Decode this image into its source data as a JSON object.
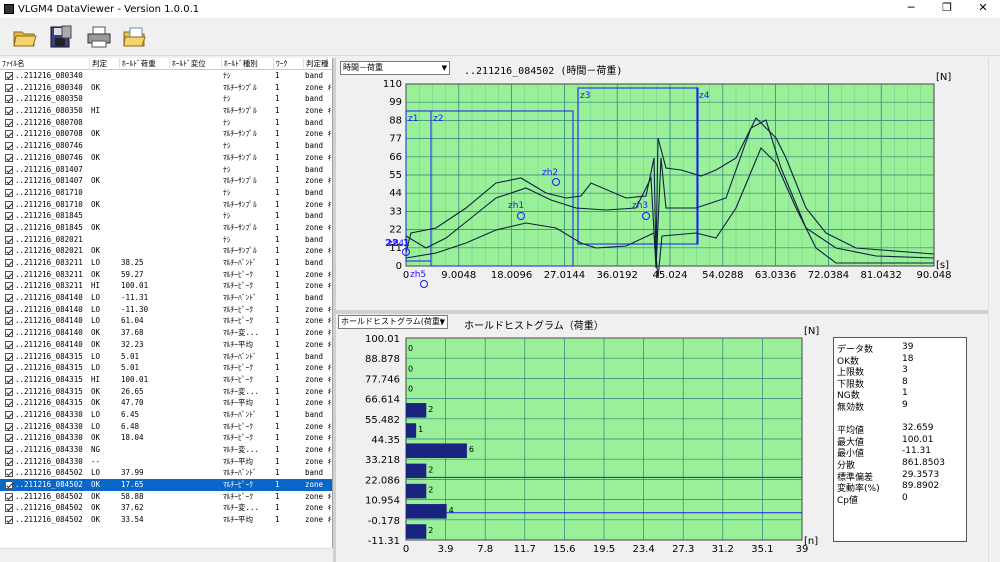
{
  "window": {
    "title": "VLGM4 DataViewer - Version 1.0.0.1",
    "minimize": "─",
    "restore": "❐",
    "close": "✕"
  },
  "toolbar": {
    "buttons": [
      "open-folder-icon",
      "save-disk-icon",
      "print-icon",
      "open-file-icon"
    ]
  },
  "list": {
    "columns": [
      "ﾌｧｲﾙ名",
      "判定",
      "ﾎｰﾙﾄﾞ荷重",
      "ﾎｰﾙﾄﾞ変位",
      "ﾎｰﾙﾄﾞ種別",
      "ﾜｰｸ",
      "判定種"
    ],
    "rows": [
      [
        "..211216_080340",
        "",
        "",
        "",
        "ﾅｼ",
        "1",
        "band"
      ],
      [
        "..211216_080340",
        "OK",
        "",
        "",
        "ﾏﾙﾁｰｻﾝﾌﾟﾙ",
        "1",
        "zone ｷ"
      ],
      [
        "..211216_080350",
        "",
        "",
        "",
        "ﾅｼ",
        "1",
        "band"
      ],
      [
        "..211216_080350",
        "HI",
        "",
        "",
        "ﾏﾙﾁｰｻﾝﾌﾟﾙ",
        "1",
        "zone ｷ"
      ],
      [
        "..211216_080708",
        "",
        "",
        "",
        "ﾅｼ",
        "1",
        "band"
      ],
      [
        "..211216_080708",
        "OK",
        "",
        "",
        "ﾏﾙﾁｰｻﾝﾌﾟﾙ",
        "1",
        "zone ｷ"
      ],
      [
        "..211216_080746",
        "",
        "",
        "",
        "ﾅｼ",
        "1",
        "band"
      ],
      [
        "..211216_080746",
        "OK",
        "",
        "",
        "ﾏﾙﾁｰｻﾝﾌﾟﾙ",
        "1",
        "zone ｷ"
      ],
      [
        "..211216_081407",
        "",
        "",
        "",
        "ﾅｼ",
        "1",
        "band"
      ],
      [
        "..211216_081407",
        "OK",
        "",
        "",
        "ﾏﾙﾁｰｻﾝﾌﾟﾙ",
        "1",
        "zone ｷ"
      ],
      [
        "..211216_081710",
        "",
        "",
        "",
        "ﾅｼ",
        "1",
        "band"
      ],
      [
        "..211216_081710",
        "OK",
        "",
        "",
        "ﾏﾙﾁｰｻﾝﾌﾟﾙ",
        "1",
        "zone ｷ"
      ],
      [
        "..211216_081845",
        "",
        "",
        "",
        "ﾅｼ",
        "1",
        "band"
      ],
      [
        "..211216_081845",
        "OK",
        "",
        "",
        "ﾏﾙﾁｰｻﾝﾌﾟﾙ",
        "1",
        "zone ｷ"
      ],
      [
        "..211216_082021",
        "",
        "",
        "",
        "ﾅｼ",
        "1",
        "band"
      ],
      [
        "..211216_082021",
        "OK",
        "",
        "",
        "ﾏﾙﾁｰｻﾝﾌﾟﾙ",
        "1",
        "zone ｷ"
      ],
      [
        "..211216_083211",
        "LO",
        "38.25",
        "",
        "ﾏﾙﾁｰﾊﾞﾝﾄﾞ",
        "1",
        "band"
      ],
      [
        "..211216_083211",
        "OK",
        "59.27",
        "",
        "ﾏﾙﾁｰﾋﾟｰｸ",
        "1",
        "zone ｷ"
      ],
      [
        "..211216_083211",
        "HI",
        "100.01",
        "",
        "ﾏﾙﾁｰﾋﾟｰｸ",
        "1",
        "zone ｷ"
      ],
      [
        "..211216_084140",
        "LO",
        "-11.31",
        "",
        "ﾏﾙﾁｰﾊﾞﾝﾄﾞ",
        "1",
        "band"
      ],
      [
        "..211216_084140",
        "LO",
        "-11.30",
        "",
        "ﾏﾙﾁｰﾋﾟｰｸ",
        "1",
        "zone ｷ"
      ],
      [
        "..211216_084140",
        "LO",
        "61.04",
        "",
        "ﾏﾙﾁｰﾋﾟｰｸ",
        "1",
        "zone ｷ"
      ],
      [
        "..211216_084140",
        "OK",
        "37.68",
        "",
        "ﾏﾙﾁｰ変...",
        "1",
        "zone ｷ"
      ],
      [
        "..211216_084140",
        "OK",
        "32.23",
        "",
        "ﾏﾙﾁｰ平均",
        "1",
        "zone ｷ"
      ],
      [
        "..211216_084315",
        "LO",
        "5.01",
        "",
        "ﾏﾙﾁｰﾊﾞﾝﾄﾞ",
        "1",
        "band"
      ],
      [
        "..211216_084315",
        "LO",
        "5.01",
        "",
        "ﾏﾙﾁｰﾋﾟｰｸ",
        "1",
        "zone ｷ"
      ],
      [
        "..211216_084315",
        "HI",
        "100.01",
        "",
        "ﾏﾙﾁｰﾋﾟｰｸ",
        "1",
        "zone ｷ"
      ],
      [
        "..211216_084315",
        "OK",
        "26.65",
        "",
        "ﾏﾙﾁｰ変...",
        "1",
        "zone ｷ"
      ],
      [
        "..211216_084315",
        "OK",
        "47.70",
        "",
        "ﾏﾙﾁｰ平均",
        "1",
        "zone ｷ"
      ],
      [
        "..211216_084330",
        "LO",
        "6.45",
        "",
        "ﾏﾙﾁｰﾊﾞﾝﾄﾞ",
        "1",
        "band"
      ],
      [
        "..211216_084330",
        "LO",
        "6.48",
        "",
        "ﾏﾙﾁｰﾋﾟｰｸ",
        "1",
        "zone ｷ"
      ],
      [
        "..211216_084330",
        "OK",
        "18.04",
        "",
        "ﾏﾙﾁｰﾋﾟｰｸ",
        "1",
        "zone ｷ"
      ],
      [
        "..211216_084330",
        "NG",
        "",
        "",
        "ﾏﾙﾁｰ変...",
        "1",
        "zone ｷ"
      ],
      [
        "..211216_084330",
        "--",
        "",
        "",
        "ﾏﾙﾁｰ平均",
        "1",
        "zone ｷ"
      ],
      [
        "..211216_084502",
        "LO",
        "37.99",
        "",
        "ﾏﾙﾁｰﾊﾞﾝﾄﾞ",
        "1",
        "band"
      ],
      [
        "..211216_084502",
        "OK",
        "17.65",
        "",
        "ﾏﾙﾁｰﾋﾟｰｸ",
        "1",
        "zone"
      ],
      [
        "..211216_084502",
        "OK",
        "58.88",
        "",
        "ﾏﾙﾁｰﾋﾟｰｸ",
        "1",
        "zone ｷ"
      ],
      [
        "..211216_084502",
        "OK",
        "37.62",
        "",
        "ﾏﾙﾁｰ変...",
        "1",
        "zone ｷ"
      ],
      [
        "..211216_084502",
        "OK",
        "33.54",
        "",
        "ﾏﾙﾁｰ平均",
        "1",
        "zone ｷ"
      ]
    ],
    "selected_row": 35
  },
  "top_chart": {
    "dropdown": "時間－荷重",
    "title": "..211216_084502 (時間－荷重)",
    "unit_y": "[N]",
    "unit_x": "[s]",
    "y_ticks": [
      "110",
      "99",
      "88",
      "77",
      "66",
      "55",
      "44",
      "33",
      "22",
      "11",
      "0"
    ],
    "x_ticks": [
      "0",
      "9.0048",
      "18.0096",
      "27.0144",
      "36.0192",
      "45.024",
      "54.0288",
      "63.0336",
      "72.0384",
      "81.0432",
      "90.048"
    ],
    "zone_labels": [
      "z1",
      "z2",
      "z3",
      "z4"
    ],
    "marker_labels": [
      "zh1",
      "zh2",
      "zh3",
      "zh4",
      "zh5"
    ],
    "cursor_label": "22.1"
  },
  "bottom_chart": {
    "dropdown": "ホールドヒストグラム(荷重)",
    "title": "ホールドヒストグラム（荷重）",
    "unit_y": "[N]",
    "unit_x": "[n]",
    "y_ticks": [
      "100.01",
      "88.878",
      "77.746",
      "66.614",
      "55.482",
      "44.35",
      "33.218",
      "22.086",
      "10.954",
      "-0.178",
      "-11.31"
    ],
    "x_ticks": [
      "0",
      "3.9",
      "7.8",
      "11.7",
      "15.6",
      "19.5",
      "23.4",
      "27.3",
      "31.2",
      "35.1",
      "39"
    ]
  },
  "chart_data": {
    "type": "bar",
    "orientation": "horizontal",
    "categories": [
      "100.01",
      "88.878",
      "77.746",
      "66.614",
      "55.482",
      "44.35",
      "33.218",
      "22.086",
      "10.954",
      "-0.178"
    ],
    "values": [
      0,
      0,
      0,
      2,
      1,
      6,
      2,
      2,
      4,
      2
    ],
    "ylabel": "[N]",
    "xlabel": "[n]",
    "xlim": [
      0,
      39
    ],
    "ylim": [
      -11.31,
      100.01
    ],
    "color": "#1a237e"
  },
  "stats": [
    [
      "データ数",
      "39"
    ],
    [
      "OK数",
      "18"
    ],
    [
      "上限数",
      "3"
    ],
    [
      "下限数",
      "8"
    ],
    [
      "NG数",
      "1"
    ],
    [
      "無効数",
      "9"
    ],
    [
      "",
      ""
    ],
    [
      "平均値",
      "32.659"
    ],
    [
      "最大値",
      "100.01"
    ],
    [
      "最小値",
      "-11.31"
    ],
    [
      "分散",
      "861.8503"
    ],
    [
      "標準偏差",
      "29.3573"
    ],
    [
      "変動率(%)",
      "89.8902"
    ],
    [
      "Cp値",
      "0"
    ]
  ],
  "colors": {
    "plot_bg": "#99f099",
    "grid": "#2f7f7f",
    "zone": "#1a1aff",
    "curve": "#102040",
    "bar": "#1a237e",
    "selection": "#0a66c8"
  }
}
